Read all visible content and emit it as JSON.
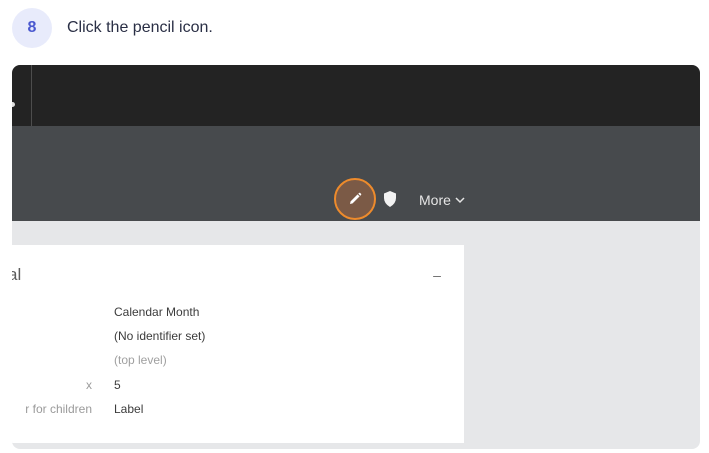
{
  "step": {
    "number": "8",
    "instruction": "Click the pencil icon."
  },
  "toolbar": {
    "edit_icon": "pencil-icon",
    "permissions_icon": "shield-icon",
    "more_label": "More",
    "more_icon": "chevron-down-icon",
    "highlight_color": "#ee8b2c"
  },
  "panel": {
    "title": "al",
    "collapse_symbol": "–",
    "rows": [
      {
        "label": "",
        "value": "Calendar Month"
      },
      {
        "label": "",
        "value": "(No identifier set)"
      },
      {
        "label": "",
        "value": "(top level)"
      },
      {
        "label": "x",
        "value": "5"
      },
      {
        "label": "r for children",
        "value": "Label"
      }
    ]
  }
}
